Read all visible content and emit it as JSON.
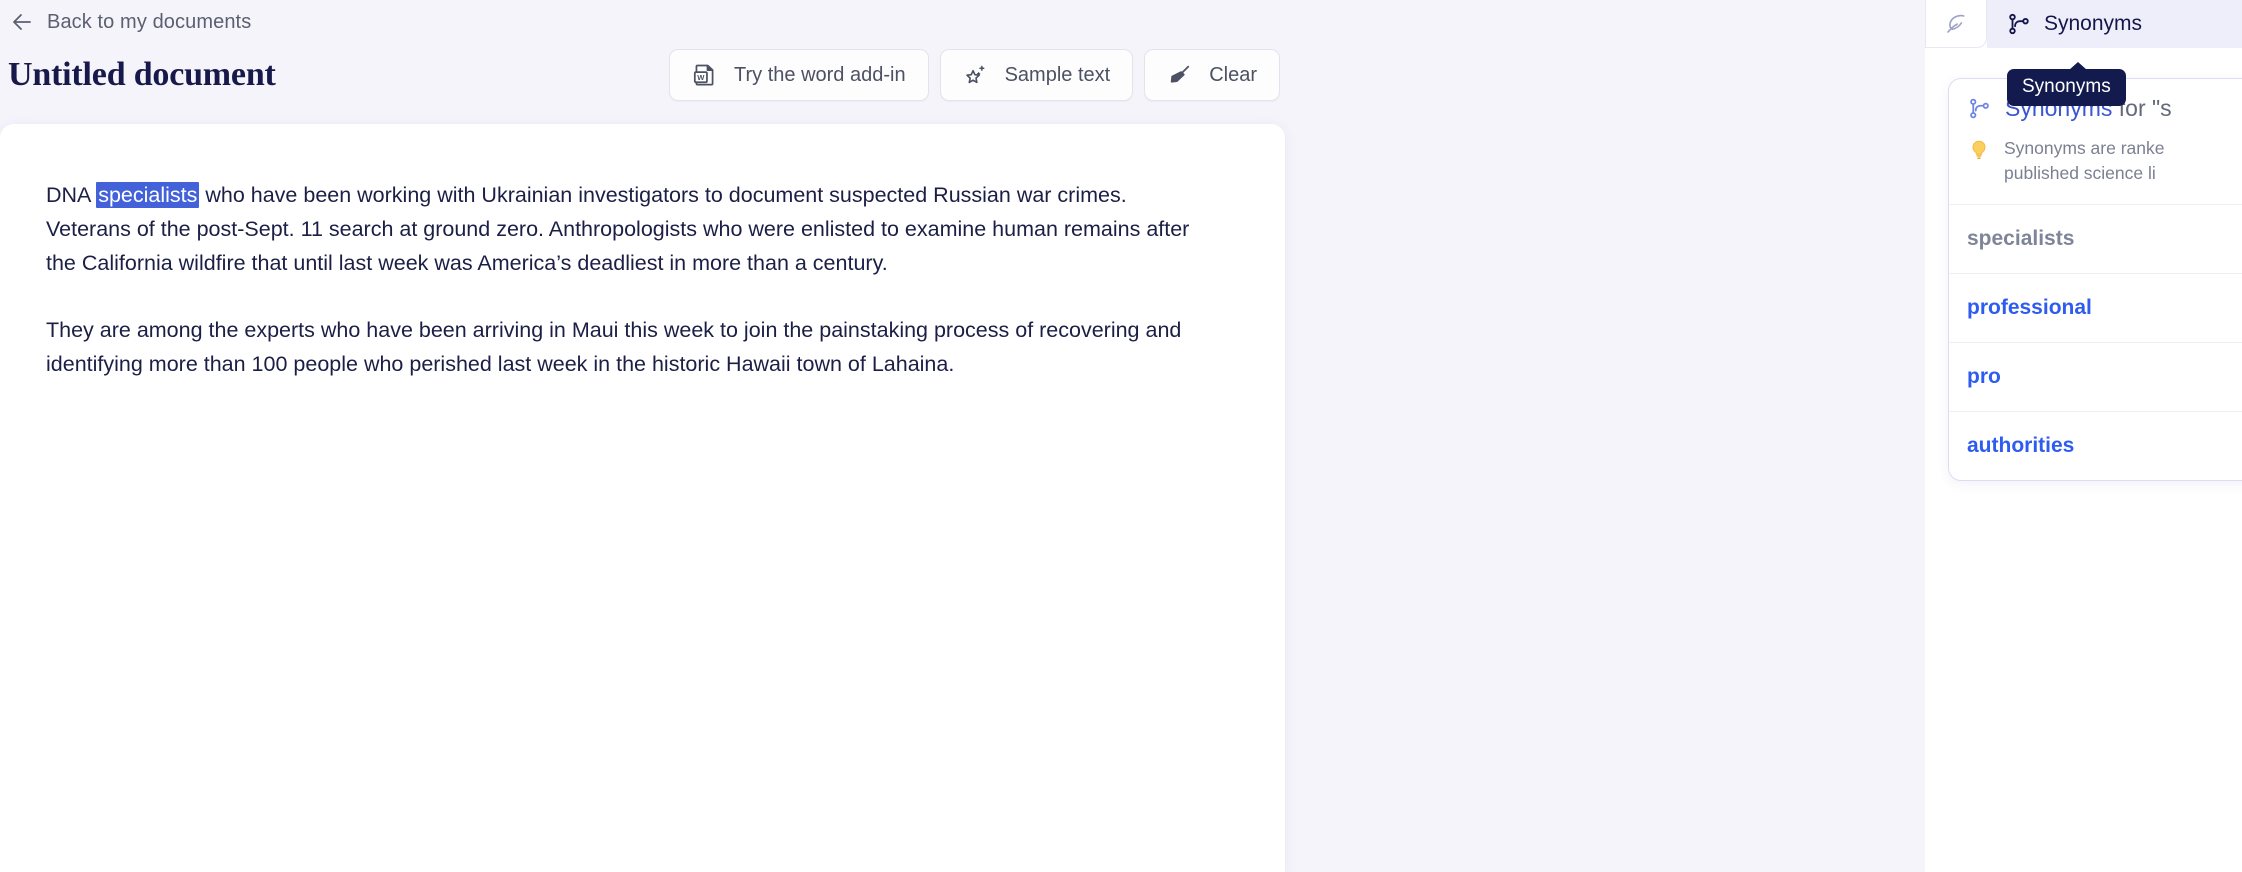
{
  "header": {
    "back_label": "Back to my documents",
    "back_icon": "arrow-left-icon",
    "doc_title": "Untitled document"
  },
  "toolbar": {
    "buttons": [
      {
        "label": "Try the word add-in",
        "icon": "word-document-icon"
      },
      {
        "label": "Sample text",
        "icon": "sparkle-star-icon"
      },
      {
        "label": "Clear",
        "icon": "broom-icon"
      }
    ]
  },
  "document": {
    "paragraphs": [
      {
        "before": "DNA ",
        "selected": "specialists",
        "after": " who have been working with Ukrainian investigators to document suspected Russian war crimes. Veterans of the post-Sept. 11 search at ground zero. Anthropologists who were enlisted to examine human remains after the California wildfire that until last week was America’s deadliest in more than a century."
      },
      {
        "text": "They are among the experts who have been arriving in Maui this week to join the painstaking process of recovering and identifying more than 100 people who perished last week in the historic Hawaii town of Lahaina."
      }
    ]
  },
  "side_panel": {
    "tabs": [
      {
        "label": "",
        "icon": "feather-quill-icon",
        "active": false
      },
      {
        "label": "Synonyms",
        "icon": "git-branch-icon",
        "active": true
      }
    ],
    "tooltip": "Synonyms",
    "card": {
      "title_strong": "Synonyms",
      "title_rest": " for \"s",
      "title_icon": "git-branch-icon",
      "hint_icon": "lightbulb-icon",
      "hint": "Synonyms are ranke\npublished science li",
      "items": [
        {
          "label": "specialists",
          "state": "current"
        },
        {
          "label": "professional",
          "state": "alt"
        },
        {
          "label": "pro",
          "state": "alt"
        },
        {
          "label": "authorities",
          "state": "alt"
        }
      ]
    }
  },
  "colors": {
    "page_bg": "#f5f4fb",
    "accent_blue": "#2f5cf0",
    "selection_blue": "#4361d8",
    "title_navy": "#17194a",
    "tooltip_navy": "#131a4d"
  }
}
